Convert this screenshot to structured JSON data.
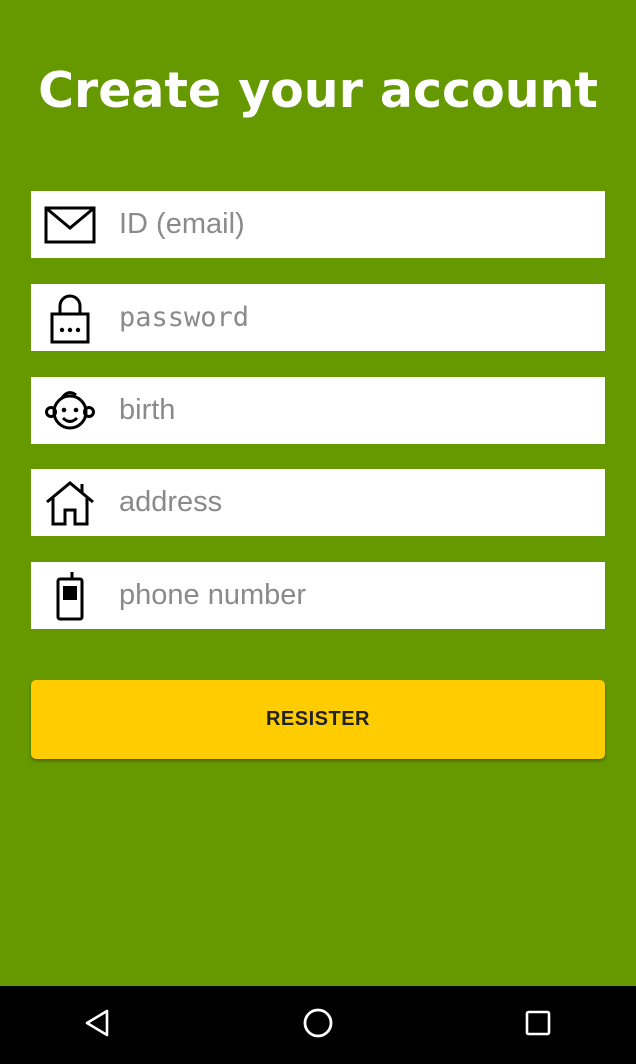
{
  "header": {
    "title": "Create your account"
  },
  "form": {
    "email": {
      "placeholder": "ID (email)",
      "value": "",
      "icon": "mail-icon"
    },
    "password": {
      "placeholder": "password",
      "value": "",
      "icon": "lock-icon"
    },
    "birth": {
      "placeholder": "birth",
      "value": "",
      "icon": "baby-face-icon"
    },
    "address": {
      "placeholder": "address",
      "value": "",
      "icon": "home-icon"
    },
    "phone": {
      "placeholder": "phone number",
      "value": "",
      "icon": "mobile-phone-icon"
    },
    "submit_label": "RESISTER"
  },
  "navbar": {
    "back": "back-icon",
    "home": "home-circle-icon",
    "recents": "recents-icon"
  },
  "colors": {
    "background": "#669900",
    "button": "#ffcc00",
    "field": "#ffffff",
    "navbar": "#000000"
  }
}
